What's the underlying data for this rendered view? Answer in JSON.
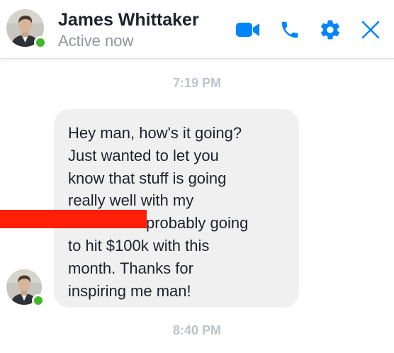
{
  "header": {
    "name": "James Whittaker",
    "status": "Active now",
    "accent_color": "#0084ff",
    "presence_color": "#42b72a",
    "icons": [
      "video-camera-icon",
      "phone-icon",
      "gear-icon",
      "close-icon"
    ]
  },
  "conversation": {
    "timestamp_1": "7:19 PM",
    "message": {
      "line_1": "Hey man, how's it going?",
      "line_2": "Just wanted to let you",
      "line_3": "know that stuff is going",
      "line_4": "really well with my",
      "line_5": "probably going",
      "line_6": "to hit $100k with this",
      "line_7": "month. Thanks for",
      "line_8": "inspiring me man!",
      "redaction_color": "#ff1e06"
    },
    "timestamp_2": "8:40 PM"
  }
}
